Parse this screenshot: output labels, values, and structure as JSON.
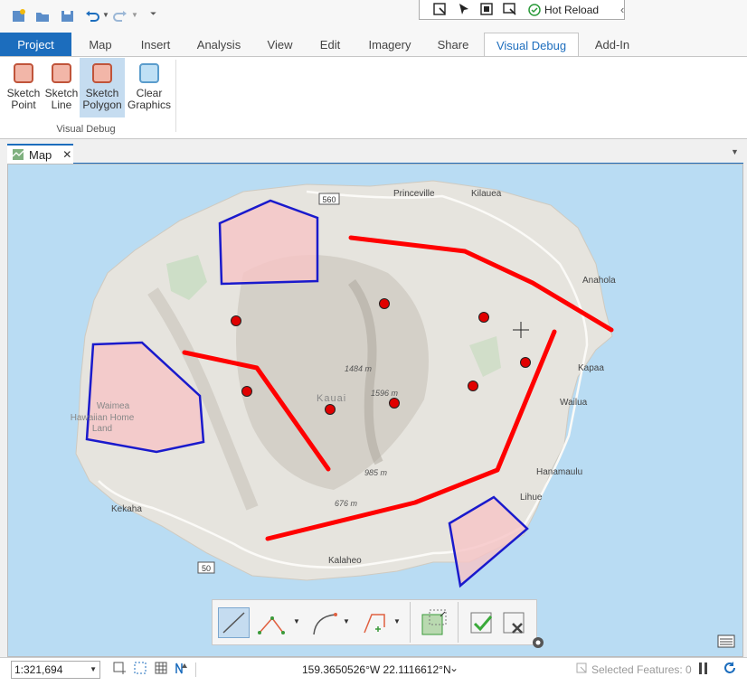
{
  "quick_access": {
    "icons": [
      "new-project-icon",
      "open-icon",
      "save-icon",
      "undo-icon",
      "redo-icon",
      "customize-icon"
    ]
  },
  "hot_reload": {
    "label": "Hot Reload"
  },
  "tabs": [
    {
      "label": "Project"
    },
    {
      "label": "Map"
    },
    {
      "label": "Insert"
    },
    {
      "label": "Analysis"
    },
    {
      "label": "View"
    },
    {
      "label": "Edit"
    },
    {
      "label": "Imagery"
    },
    {
      "label": "Share"
    },
    {
      "label": "Visual Debug"
    },
    {
      "label": "Add-In"
    }
  ],
  "active_tab": "Visual Debug",
  "ribbon": {
    "group_label": "Visual Debug",
    "buttons": [
      {
        "line1": "Sketch",
        "line2": "Point",
        "selected": false
      },
      {
        "line1": "Sketch",
        "line2": "Line",
        "selected": false
      },
      {
        "line1": "Sketch",
        "line2": "Polygon",
        "selected": true
      },
      {
        "line1": "Clear",
        "line2": "Graphics",
        "selected": false
      }
    ]
  },
  "map_tab": {
    "label": "Map",
    "close": "✕"
  },
  "map": {
    "labels": {
      "princeville": "Princeville",
      "kilauea": "Kilauea",
      "anahola": "Anahola",
      "kapaa": "Kapaa",
      "wailua": "Wailua",
      "hanamaulu": "Hanamaulu",
      "lihue": "Lihue",
      "kekaha": "Kekaha",
      "kalaheo": "Kalaheo",
      "kauai": "Kauai",
      "waimea1": "Waimea",
      "waimea2": "Hawaiian Home",
      "waimea3": "Land",
      "elev1": "1484 m",
      "elev2": "1596 m",
      "elev3": "985 m",
      "elev4": "676 m",
      "route560": "560",
      "route50": "50"
    },
    "colors": {
      "sketch_line": "#ff0000",
      "polygon_fill": "#f6c4c6",
      "polygon_outline": "#1a1acc",
      "point": "#e00000",
      "water": "#b9dcf3",
      "land": "#ededea"
    }
  },
  "status": {
    "scale": "1:321,694",
    "coordinates": "159.3650526°W 22.1116612°N",
    "selected_features": "Selected Features: 0"
  }
}
